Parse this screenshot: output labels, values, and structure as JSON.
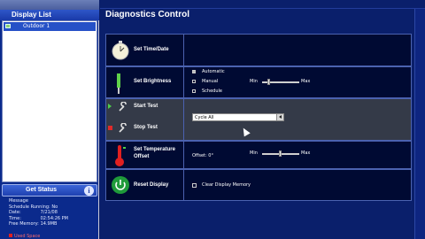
{
  "sidebar": {
    "header": "Display List",
    "items": [
      {
        "label": "Outdoor 1"
      }
    ],
    "get_status_label": "Get Status",
    "info": [
      {
        "label": "Message",
        "value": ""
      },
      {
        "label": "Schedule Running:",
        "value": "No"
      },
      {
        "label": "Date:",
        "value": "7/21/08"
      },
      {
        "label": "Time:",
        "value": "02:54:26 PM"
      },
      {
        "label": "Free Memory:",
        "value": "14.9MB"
      }
    ],
    "used_space": "Used Space"
  },
  "main": {
    "title": "Diagnostics Control",
    "rows": {
      "time": {
        "label": "Set Time/Date"
      },
      "brightness": {
        "label": "Set Brightness",
        "options": [
          {
            "label": "Automatic",
            "selected": true
          },
          {
            "label": "Manual",
            "selected": false
          },
          {
            "label": "Schedule",
            "selected": false
          }
        ],
        "slider": {
          "min_label": "Min",
          "max_label": "Max",
          "level": 0.2
        }
      },
      "test": {
        "start_label": "Start Test",
        "stop_label": "Stop Test",
        "select_value": "Cycle All"
      },
      "temperature": {
        "label_line1": "Set Temperature",
        "label_line2": "Offset",
        "offset_text": "Offset: 0°",
        "slider": {
          "min_label": "Min",
          "max_label": "Max",
          "level": 0.5
        }
      },
      "reset": {
        "label": "Reset Display",
        "checkbox_label": "Clear Display Memory",
        "checked": false
      }
    }
  },
  "colors": {
    "background": "#0a1f6b",
    "panel": "#000a33",
    "highlight_row": "#343a48",
    "accent": "#2651c7"
  }
}
